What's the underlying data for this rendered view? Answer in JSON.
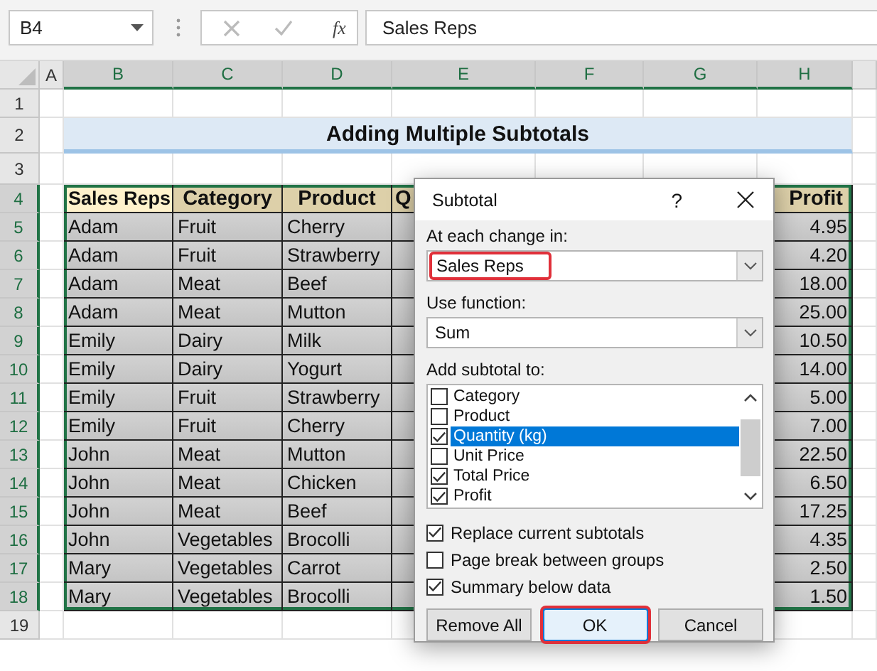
{
  "name_box": "B4",
  "formula_bar": {
    "fx": "fx",
    "value": "Sales Reps"
  },
  "column_headers": [
    "A",
    "B",
    "C",
    "D",
    "E",
    "F",
    "G",
    "H"
  ],
  "row_headers": [
    "1",
    "2",
    "3",
    "4",
    "5",
    "6",
    "7",
    "8",
    "9",
    "10",
    "11",
    "12",
    "13",
    "14",
    "15",
    "16",
    "17",
    "18",
    "19"
  ],
  "title": "Adding Multiple Subtotals",
  "table": {
    "columns": [
      "Sales Reps",
      "Category",
      "Product",
      "Q",
      "Profit"
    ],
    "rows": [
      [
        "Adam",
        "Fruit",
        "Cherry",
        "4.95"
      ],
      [
        "Adam",
        "Fruit",
        "Strawberry",
        "4.20"
      ],
      [
        "Adam",
        "Meat",
        "Beef",
        "18.00"
      ],
      [
        "Adam",
        "Meat",
        "Mutton",
        "25.00"
      ],
      [
        "Emily",
        "Dairy",
        "Milk",
        "10.50"
      ],
      [
        "Emily",
        "Dairy",
        "Yogurt",
        "14.00"
      ],
      [
        "Emily",
        "Fruit",
        "Strawberry",
        "5.00"
      ],
      [
        "Emily",
        "Fruit",
        "Cherry",
        "7.00"
      ],
      [
        "John",
        "Meat",
        "Mutton",
        "22.50"
      ],
      [
        "John",
        "Meat",
        "Chicken",
        "6.50"
      ],
      [
        "John",
        "Meat",
        "Beef",
        "17.25"
      ],
      [
        "John",
        "Vegetables",
        "Brocolli",
        "4.35"
      ],
      [
        "Mary",
        "Vegetables",
        "Carrot",
        "2.50"
      ],
      [
        "Mary",
        "Vegetables",
        "Brocolli",
        "1.50"
      ]
    ]
  },
  "dialog": {
    "title": "Subtotal",
    "help": "?",
    "change_label": "At each change in:",
    "change_value": "Sales Reps",
    "change_annotated": true,
    "function_label": "Use function:",
    "function_value": "Sum",
    "add_label": "Add subtotal to:",
    "fields": [
      {
        "label": "Category",
        "checked": false,
        "selected": false
      },
      {
        "label": "Product",
        "checked": false,
        "selected": false
      },
      {
        "label": "Quantity (kg)",
        "checked": true,
        "selected": true
      },
      {
        "label": "Unit Price",
        "checked": false,
        "selected": false
      },
      {
        "label": "Total Price",
        "checked": true,
        "selected": false
      },
      {
        "label": "Profit",
        "checked": true,
        "selected": false
      }
    ],
    "options": [
      {
        "label": "Replace current subtotals",
        "checked": true
      },
      {
        "label": "Page break between groups",
        "checked": false
      },
      {
        "label": "Summary below data",
        "checked": true
      }
    ],
    "buttons": [
      {
        "label": "Remove All",
        "default": false,
        "annotated": false
      },
      {
        "label": "OK",
        "default": true,
        "annotated": true
      },
      {
        "label": "Cancel",
        "default": false,
        "annotated": false
      }
    ]
  }
}
